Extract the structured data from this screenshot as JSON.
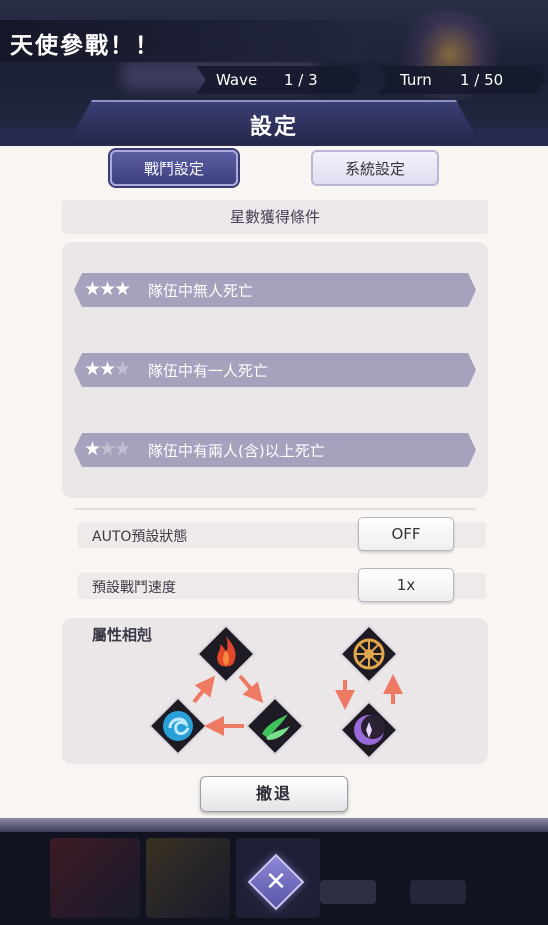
{
  "hud": {
    "stage_title": "天使參戰！！",
    "wave_label": "Wave",
    "wave_value": "1 / 3",
    "turn_label": "Turn",
    "turn_value": "1 / 50"
  },
  "panel": {
    "title": "設定",
    "tabs": [
      {
        "label": "戰鬥設定",
        "active": true
      },
      {
        "label": "系統設定",
        "active": false
      }
    ],
    "star_section_title": "星數獲得條件",
    "conditions": [
      {
        "stars": 3,
        "text": "隊伍中無人死亡"
      },
      {
        "stars": 2,
        "text": "隊伍中有一人死亡"
      },
      {
        "stars": 1,
        "text": "隊伍中有兩人(含)以上死亡"
      }
    ],
    "options": [
      {
        "label": "AUTO預設狀態",
        "value": "OFF"
      },
      {
        "label": "預設戰鬥速度",
        "value": "1x"
      }
    ],
    "element_title": "屬性相剋",
    "elements": {
      "fire": {
        "icon": "fire-icon",
        "color": "#e2462b"
      },
      "water": {
        "icon": "water-icon",
        "color": "#2aa0d8"
      },
      "wind": {
        "icon": "wind-icon",
        "color": "#3ec35a"
      },
      "light": {
        "icon": "light-icon",
        "color": "#e0a64a"
      },
      "dark": {
        "icon": "dark-icon",
        "color": "#9a6ad8"
      },
      "arrow_color": "#ef7a63"
    },
    "retreat_label": "撤退"
  },
  "close_label": "✕"
}
